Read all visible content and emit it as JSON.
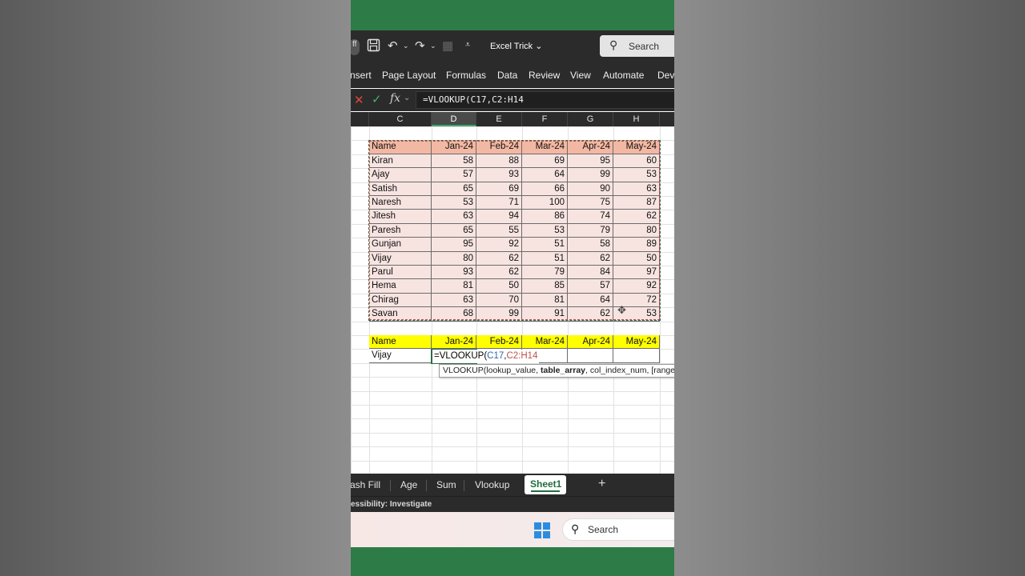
{
  "qat": {
    "title": "Excel Trick",
    "search_label": "Search",
    "autosave_fragment": "ff"
  },
  "ribbon": {
    "tabs": [
      "nsert",
      "Page Layout",
      "Formulas",
      "Data",
      "Review",
      "View",
      "Automate",
      "Dev"
    ]
  },
  "formula_bar": {
    "value": "=VLOOKUP(C17,C2:H14"
  },
  "columns": [
    "C",
    "D",
    "E",
    "F",
    "G",
    "H"
  ],
  "selected_column": "D",
  "table1": {
    "headers": [
      "Name",
      "Jan-24",
      "Feb-24",
      "Mar-24",
      "Apr-24",
      "May-24"
    ],
    "rows": [
      [
        "Kiran",
        "58",
        "88",
        "69",
        "95",
        "60"
      ],
      [
        "Ajay",
        "57",
        "93",
        "64",
        "99",
        "53"
      ],
      [
        "Satish",
        "65",
        "69",
        "66",
        "90",
        "63"
      ],
      [
        "Naresh",
        "53",
        "71",
        "100",
        "75",
        "87"
      ],
      [
        "Jitesh",
        "63",
        "94",
        "86",
        "74",
        "62"
      ],
      [
        "Paresh",
        "65",
        "55",
        "53",
        "79",
        "80"
      ],
      [
        "Gunjan",
        "95",
        "92",
        "51",
        "58",
        "89"
      ],
      [
        "Vijay",
        "80",
        "62",
        "51",
        "62",
        "50"
      ],
      [
        "Parul",
        "93",
        "62",
        "79",
        "84",
        "97"
      ],
      [
        "Hema",
        "81",
        "50",
        "85",
        "57",
        "92"
      ],
      [
        "Chirag",
        "63",
        "70",
        "81",
        "64",
        "72"
      ],
      [
        "Savan",
        "68",
        "99",
        "91",
        "62",
        "53"
      ]
    ]
  },
  "table2": {
    "headers": [
      "Name",
      "Jan-24",
      "Feb-24",
      "Mar-24",
      "Apr-24",
      "May-24"
    ],
    "name_value": "Vijay"
  },
  "editing": {
    "prefix": "=VLOOKUP(",
    "ref1": "C17",
    "comma": ",",
    "ref2": "C2:H14"
  },
  "tooltip": {
    "func": "VLOOKUP(",
    "arg1": "lookup_value, ",
    "arg2": "table_array",
    "rest": ", col_index_num, [range_lookup])"
  },
  "sheets": {
    "tabs": [
      "ash Fill",
      "Age",
      "Sum",
      "Vlookup"
    ],
    "active": "Sheet1",
    "add_label": "+"
  },
  "status": {
    "text": "essibility: Investigate"
  },
  "taskbar": {
    "search_label": "Search"
  }
}
